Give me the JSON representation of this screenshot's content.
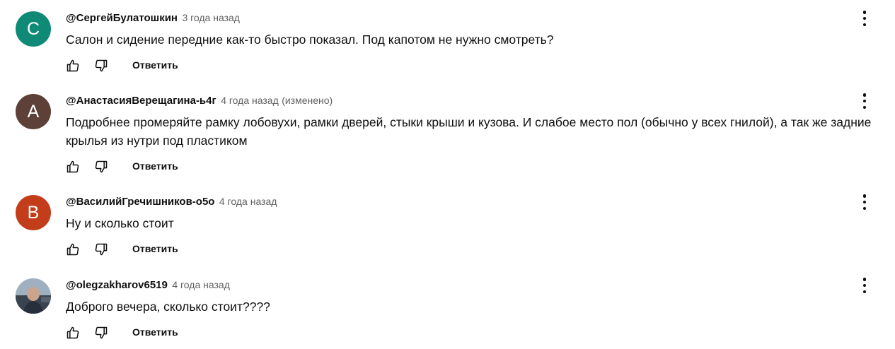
{
  "reply_label": "Ответить",
  "colors": {
    "avatar_c": "#0f8a76",
    "avatar_a": "#5d4037",
    "avatar_b": "#c43d1b"
  },
  "comments": [
    {
      "author": "@СергейБулатошкин",
      "time": "3 года назад",
      "edited": "",
      "avatar_letter": "С",
      "text": "Салон и сидение передние как-то быстро показал. Под капотом не нужно смотреть?"
    },
    {
      "author": "@АнастасияВерещагина-ь4г",
      "time": "4 года назад",
      "edited": "(изменено)",
      "avatar_letter": "A",
      "text": "Подробнее промеряйте рамку лобовухи, рамки дверей, стыки крыши и кузова. И слабое место пол (обычно у всех гнилой), а так же задние крылья из нутри под пластиком"
    },
    {
      "author": "@ВасилийГречишников-о5о",
      "time": "4 года назад",
      "edited": "",
      "avatar_letter": "B",
      "text": "Ну и сколько стоит"
    },
    {
      "author": "@olegzakharov6519",
      "time": "4 года назад",
      "edited": "",
      "avatar_letter": "",
      "text": "Доброго вечера, сколько стоит????"
    }
  ]
}
